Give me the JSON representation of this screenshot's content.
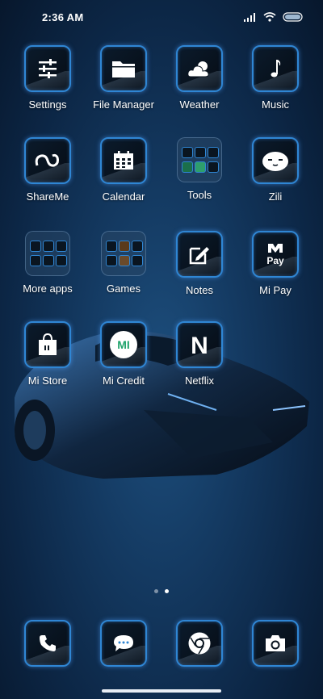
{
  "status_bar": {
    "time": "2:36 AM"
  },
  "apps": [
    {
      "label": "Settings",
      "icon": "sliders-icon"
    },
    {
      "label": "File Manager",
      "icon": "folder-icon"
    },
    {
      "label": "Weather",
      "icon": "cloud-sun-icon"
    },
    {
      "label": "Music",
      "icon": "music-note-icon"
    },
    {
      "label": "ShareMe",
      "icon": "infinity-icon"
    },
    {
      "label": "Calendar",
      "icon": "calendar-icon"
    },
    {
      "label": "Tools",
      "icon": "folder-tools"
    },
    {
      "label": "Zili",
      "icon": "face-icon"
    },
    {
      "label": "More apps",
      "icon": "folder-more-apps"
    },
    {
      "label": "Games",
      "icon": "folder-games"
    },
    {
      "label": "Notes",
      "icon": "pencil-note-icon"
    },
    {
      "label": "Mi Pay",
      "icon": "mi-pay-icon",
      "icon_text": "Pay"
    },
    {
      "label": "Mi Store",
      "icon": "shopping-bag-icon"
    },
    {
      "label": "Mi Credit",
      "icon": "mi-credit-icon",
      "icon_text": "MI"
    },
    {
      "label": "Netflix",
      "icon": "netflix-icon",
      "icon_text": "N"
    }
  ],
  "page_indicator": {
    "count": 2,
    "active": 2
  },
  "dock": [
    {
      "icon": "phone-icon"
    },
    {
      "icon": "messages-icon"
    },
    {
      "icon": "chrome-icon"
    },
    {
      "icon": "camera-icon"
    }
  ],
  "colors": {
    "accent": "#2f86d4",
    "background": "#143a62"
  }
}
